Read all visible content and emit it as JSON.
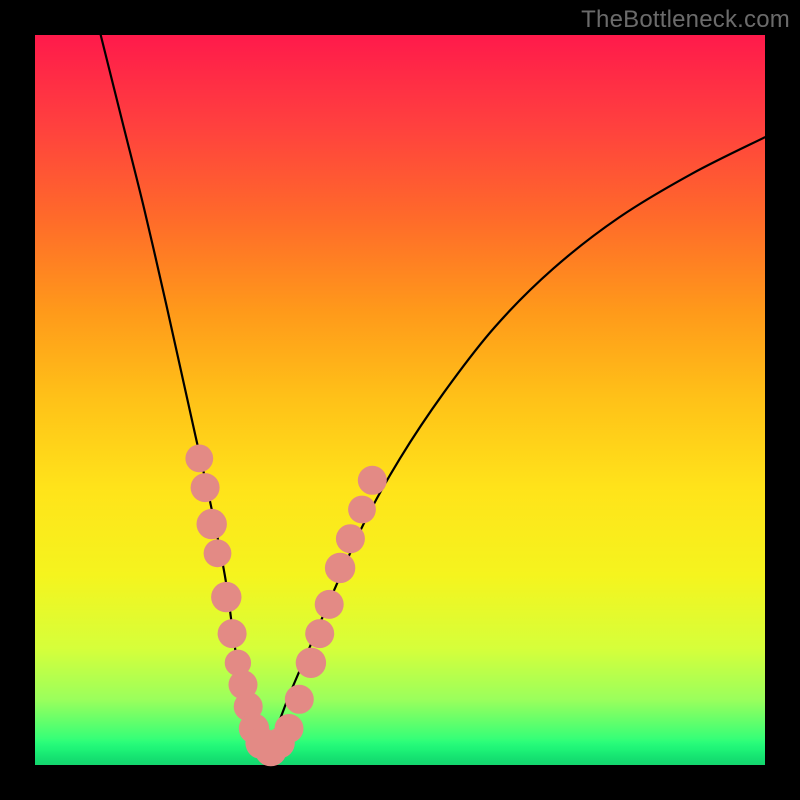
{
  "watermark": "TheBottleneck.com",
  "colors": {
    "gradient_top": "#ff1a4b",
    "gradient_bottom": "#00e66a",
    "curve": "#000000",
    "bead": "#e38a85",
    "frame": "#000000"
  },
  "chart_data": {
    "type": "line",
    "title": "",
    "xlabel": "",
    "ylabel": "",
    "xlim": [
      0,
      100
    ],
    "ylim": [
      0,
      100
    ],
    "grid": false,
    "legend": false,
    "note": "Axes unlabeled; values estimated in percent of plot area where 0,0 is bottom-left.",
    "series": [
      {
        "name": "left-curve",
        "x": [
          9,
          12,
          15,
          18,
          20,
          22,
          24,
          26,
          27,
          28,
          29,
          30,
          31
        ],
        "y": [
          100,
          88,
          76,
          63,
          54,
          45,
          36,
          26,
          19,
          12,
          8,
          4,
          2
        ]
      },
      {
        "name": "right-curve",
        "x": [
          31,
          33,
          35,
          38,
          41,
          45,
          50,
          56,
          63,
          71,
          80,
          90,
          100
        ],
        "y": [
          2,
          5,
          10,
          17,
          24,
          33,
          42,
          51,
          60,
          68,
          75,
          81,
          86
        ]
      }
    ],
    "beads": {
      "note": "Highlighted markers clustered near the curve minimum.",
      "points": [
        {
          "x": 22.5,
          "y": 42,
          "r": 1.2
        },
        {
          "x": 23.3,
          "y": 38,
          "r": 1.3
        },
        {
          "x": 24.2,
          "y": 33,
          "r": 1.4
        },
        {
          "x": 25.0,
          "y": 29,
          "r": 1.2
        },
        {
          "x": 26.2,
          "y": 23,
          "r": 1.4
        },
        {
          "x": 27.0,
          "y": 18,
          "r": 1.3
        },
        {
          "x": 27.8,
          "y": 14,
          "r": 1.1
        },
        {
          "x": 28.5,
          "y": 11,
          "r": 1.3
        },
        {
          "x": 29.2,
          "y": 8,
          "r": 1.3
        },
        {
          "x": 30.0,
          "y": 5,
          "r": 1.4
        },
        {
          "x": 31.0,
          "y": 3,
          "r": 1.5
        },
        {
          "x": 32.3,
          "y": 2,
          "r": 1.5
        },
        {
          "x": 33.5,
          "y": 3,
          "r": 1.4
        },
        {
          "x": 34.8,
          "y": 5,
          "r": 1.3
        },
        {
          "x": 36.2,
          "y": 9,
          "r": 1.3
        },
        {
          "x": 37.8,
          "y": 14,
          "r": 1.4
        },
        {
          "x": 39.0,
          "y": 18,
          "r": 1.3
        },
        {
          "x": 40.3,
          "y": 22,
          "r": 1.3
        },
        {
          "x": 41.8,
          "y": 27,
          "r": 1.4
        },
        {
          "x": 43.2,
          "y": 31,
          "r": 1.3
        },
        {
          "x": 44.8,
          "y": 35,
          "r": 1.2
        },
        {
          "x": 46.2,
          "y": 39,
          "r": 1.3
        }
      ]
    }
  }
}
